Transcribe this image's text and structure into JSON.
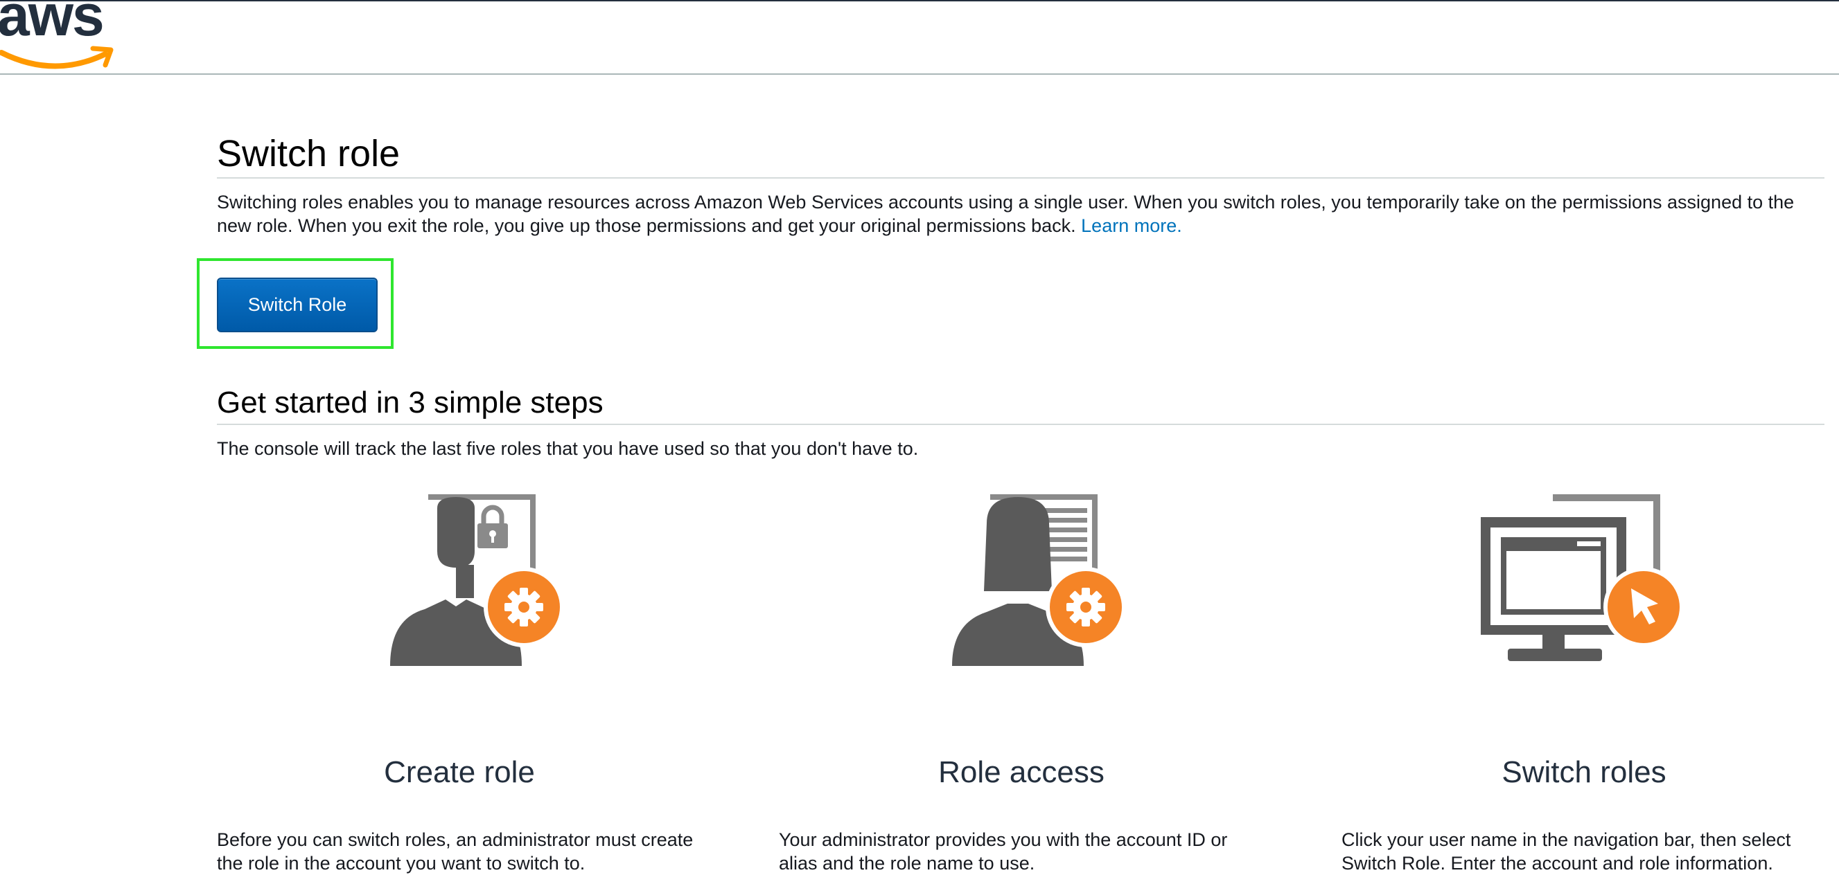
{
  "brand": {
    "logo_text": "aws",
    "accent": "#ff9900",
    "dark": "#232f3e"
  },
  "switch_role": {
    "title": "Switch role",
    "description": "Switching roles enables you to manage resources across Amazon Web Services accounts using a single user. When you switch roles, you temporarily take on the permissions assigned to the new role. When you exit the role, you give up those permissions and get your original permissions back.",
    "learn_more": "Learn more.",
    "button_label": "Switch Role"
  },
  "get_started": {
    "title": "Get started in 3 simple steps",
    "description": "The console will track the last five roles that you have used so that you don't have to."
  },
  "steps": [
    {
      "icon": "admin-lock-gear-icon",
      "title": "Create role",
      "description": "Before you can switch roles, an administrator must create the role in the account you want to switch to."
    },
    {
      "icon": "user-document-gear-icon",
      "title": "Role access",
      "description": "Your administrator provides you with the account ID or alias and the role name to use."
    },
    {
      "icon": "monitor-cursor-icon",
      "title": "Switch roles",
      "description": "Click your user name in the navigation bar, then select Switch Role. Enter the account and role information."
    }
  ],
  "colors": {
    "link": "#0073bb",
    "button": "#0a6ebd",
    "icon_gray": "#5a5a5a",
    "icon_orange": "#f58426",
    "highlight": "#2fe62f"
  }
}
